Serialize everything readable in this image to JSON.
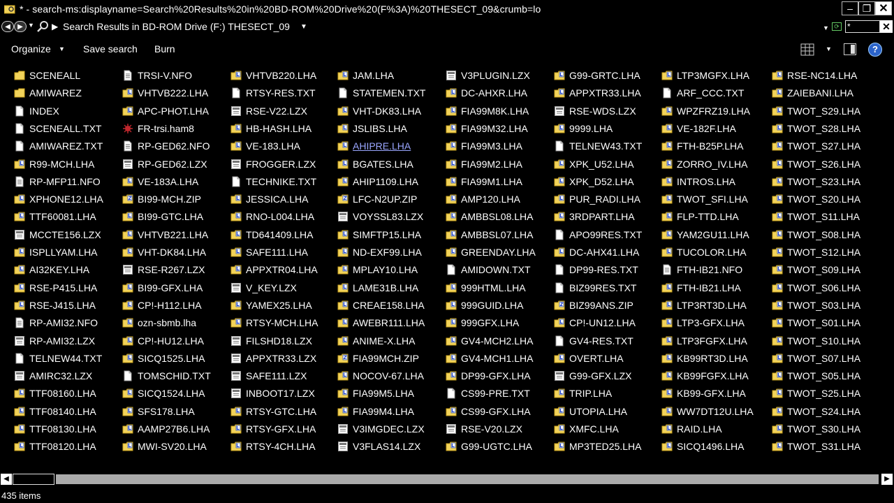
{
  "window": {
    "title": "* - search-ms:displayname=Search%20Results%20in%20BD-ROM%20Drive%20(F%3A)%20THESECT_09&crumb=lo",
    "minimize_glyph": "–",
    "maximize_glyph": "❐",
    "close_glyph": "✕"
  },
  "address": {
    "back_glyph": "◀",
    "forward_glyph": "▶",
    "location": "Search Results in BD-ROM Drive (F:) THESECT_09",
    "search_value": "*",
    "clear_glyph": "✕"
  },
  "toolbar": {
    "organize_label": "Organize",
    "save_search_label": "Save search",
    "burn_label": "Burn",
    "help_label": "?"
  },
  "colors": {
    "folder": "#f2d35a",
    "folder_dark": "#c9a21e",
    "doc": "#ffffff",
    "link_text": "#9aa6ff",
    "help_blue": "#2b63c9"
  },
  "columns": [
    [
      {
        "name": "SCENEALL",
        "icon": "folder"
      },
      {
        "name": "AMIWAREZ",
        "icon": "folder"
      },
      {
        "name": "INDEX",
        "icon": "doc"
      },
      {
        "name": "SCENEALL.TXT",
        "icon": "doc"
      },
      {
        "name": "AMIWAREZ.TXT",
        "icon": "doc"
      },
      {
        "name": "R99-MCH.LHA",
        "icon": "archive"
      },
      {
        "name": "RP-MFP11.NFO",
        "icon": "nfo"
      },
      {
        "name": "XPHONE12.LHA",
        "icon": "archive"
      },
      {
        "name": "TTF60081.LHA",
        "icon": "archive"
      },
      {
        "name": "MCCTE156.LZX",
        "icon": "lzx"
      },
      {
        "name": "ISPLLYAM.LHA",
        "icon": "archive"
      },
      {
        "name": "AI32KEY.LHA",
        "icon": "archive"
      },
      {
        "name": "RSE-P415.LHA",
        "icon": "archive"
      },
      {
        "name": "RSE-J415.LHA",
        "icon": "archive"
      },
      {
        "name": "RP-AMI32.NFO",
        "icon": "nfo"
      },
      {
        "name": "RP-AMI32.LZX",
        "icon": "lzx"
      },
      {
        "name": "TELNEW44.TXT",
        "icon": "doc"
      },
      {
        "name": "AMIRC32.LZX",
        "icon": "lzx"
      },
      {
        "name": "TTF08160.LHA",
        "icon": "archive"
      },
      {
        "name": "TTF08140.LHA",
        "icon": "archive"
      },
      {
        "name": "TTF08130.LHA",
        "icon": "archive"
      },
      {
        "name": "TTF08120.LHA",
        "icon": "archive"
      }
    ],
    [
      {
        "name": "TRSI-V.NFO",
        "icon": "nfo"
      },
      {
        "name": "VHTVB222.LHA",
        "icon": "archive"
      },
      {
        "name": "APC-PHOT.LHA",
        "icon": "archive"
      },
      {
        "name": "FR-trsi.ham8",
        "icon": "ham8"
      },
      {
        "name": "RP-GED62.NFO",
        "icon": "nfo"
      },
      {
        "name": "RP-GED62.LZX",
        "icon": "lzx"
      },
      {
        "name": "VE-183A.LHA",
        "icon": "archive"
      },
      {
        "name": "BI99-MCH.ZIP",
        "icon": "zip"
      },
      {
        "name": "BI99-GTC.LHA",
        "icon": "archive"
      },
      {
        "name": "VHTVB221.LHA",
        "icon": "archive"
      },
      {
        "name": "VHT-DK84.LHA",
        "icon": "archive"
      },
      {
        "name": "RSE-R267.LZX",
        "icon": "lzx"
      },
      {
        "name": "BI99-GFX.LHA",
        "icon": "archive"
      },
      {
        "name": "CP!-H112.LHA",
        "icon": "archive"
      },
      {
        "name": "ozn-sbmb.lha",
        "icon": "archive"
      },
      {
        "name": "CP!-HU12.LHA",
        "icon": "archive"
      },
      {
        "name": "SICQ1525.LHA",
        "icon": "archive"
      },
      {
        "name": "TOMSCHID.TXT",
        "icon": "doc"
      },
      {
        "name": "SICQ1524.LHA",
        "icon": "archive"
      },
      {
        "name": "SFS178.LHA",
        "icon": "archive"
      },
      {
        "name": "AAMP27B6.LHA",
        "icon": "archive"
      },
      {
        "name": "MWI-SV20.LHA",
        "icon": "archive"
      }
    ],
    [
      {
        "name": "VHTVB220.LHA",
        "icon": "archive"
      },
      {
        "name": "RTSY-RES.TXT",
        "icon": "doc"
      },
      {
        "name": "RSE-V22.LZX",
        "icon": "lzx"
      },
      {
        "name": "HB-HASH.LHA",
        "icon": "archive"
      },
      {
        "name": "VE-183.LHA",
        "icon": "archive"
      },
      {
        "name": "FROGGER.LZX",
        "icon": "lzx"
      },
      {
        "name": "TECHNIKE.TXT",
        "icon": "doc"
      },
      {
        "name": "JESSICA.LHA",
        "icon": "archive"
      },
      {
        "name": "RNO-L004.LHA",
        "icon": "archive"
      },
      {
        "name": "TD641409.LHA",
        "icon": "archive"
      },
      {
        "name": "SAFE111.LHA",
        "icon": "archive"
      },
      {
        "name": "APPXTR04.LHA",
        "icon": "archive"
      },
      {
        "name": "V_KEY.LZX",
        "icon": "lzx"
      },
      {
        "name": "YAMEX25.LHA",
        "icon": "archive"
      },
      {
        "name": "RTSY-MCH.LHA",
        "icon": "archive"
      },
      {
        "name": "FILSHD18.LZX",
        "icon": "lzx"
      },
      {
        "name": "APPXTR33.LZX",
        "icon": "lzx"
      },
      {
        "name": "SAFE111.LZX",
        "icon": "lzx"
      },
      {
        "name": "INBOOT17.LZX",
        "icon": "lzx"
      },
      {
        "name": "RTSY-GTC.LHA",
        "icon": "archive"
      },
      {
        "name": "RTSY-GFX.LHA",
        "icon": "archive"
      },
      {
        "name": "RTSY-4CH.LHA",
        "icon": "archive"
      }
    ],
    [
      {
        "name": "JAM.LHA",
        "icon": "archive"
      },
      {
        "name": "STATEMEN.TXT",
        "icon": "doc"
      },
      {
        "name": "VHT-DK83.LHA",
        "icon": "archive"
      },
      {
        "name": "JSLIBS.LHA",
        "icon": "archive"
      },
      {
        "name": "AHIPRE.LHA",
        "icon": "archive",
        "link": true
      },
      {
        "name": "BGATES.LHA",
        "icon": "archive"
      },
      {
        "name": "AHIP1109.LHA",
        "icon": "archive"
      },
      {
        "name": "LFC-N2UP.ZIP",
        "icon": "zip"
      },
      {
        "name": "VOYSSL83.LZX",
        "icon": "lzx"
      },
      {
        "name": "SIMFTP15.LHA",
        "icon": "archive"
      },
      {
        "name": "ND-EXF99.LHA",
        "icon": "archive"
      },
      {
        "name": "MPLAY10.LHA",
        "icon": "archive"
      },
      {
        "name": "LAME31B.LHA",
        "icon": "archive"
      },
      {
        "name": "CREAE158.LHA",
        "icon": "archive"
      },
      {
        "name": "AWEBR111.LHA",
        "icon": "archive"
      },
      {
        "name": "ANIME-X.LHA",
        "icon": "archive"
      },
      {
        "name": "FIA99MCH.ZIP",
        "icon": "zip"
      },
      {
        "name": "NOCOV-67.LHA",
        "icon": "archive"
      },
      {
        "name": "FIA99M5.LHA",
        "icon": "archive"
      },
      {
        "name": "FIA99M4.LHA",
        "icon": "archive"
      },
      {
        "name": "V3IMGDEC.LZX",
        "icon": "lzx"
      },
      {
        "name": "V3FLAS14.LZX",
        "icon": "lzx"
      }
    ],
    [
      {
        "name": "V3PLUGIN.LZX",
        "icon": "lzx"
      },
      {
        "name": "DC-AHXR.LHA",
        "icon": "archive"
      },
      {
        "name": "FIA99M8K.LHA",
        "icon": "archive"
      },
      {
        "name": "FIA99M32.LHA",
        "icon": "archive"
      },
      {
        "name": "FIA99M3.LHA",
        "icon": "archive"
      },
      {
        "name": "FIA99M2.LHA",
        "icon": "archive"
      },
      {
        "name": "FIA99M1.LHA",
        "icon": "archive"
      },
      {
        "name": "AMP120.LHA",
        "icon": "archive"
      },
      {
        "name": "AMBBSL08.LHA",
        "icon": "archive"
      },
      {
        "name": "AMBBSL07.LHA",
        "icon": "archive"
      },
      {
        "name": "GREENDAY.LHA",
        "icon": "archive"
      },
      {
        "name": "AMIDOWN.TXT",
        "icon": "doc"
      },
      {
        "name": "999HTML.LHA",
        "icon": "archive"
      },
      {
        "name": "999GUID.LHA",
        "icon": "archive"
      },
      {
        "name": "999GFX.LHA",
        "icon": "archive"
      },
      {
        "name": "GV4-MCH2.LHA",
        "icon": "archive"
      },
      {
        "name": "GV4-MCH1.LHA",
        "icon": "archive"
      },
      {
        "name": "DP99-GFX.LHA",
        "icon": "archive"
      },
      {
        "name": "CS99-PRE.TXT",
        "icon": "doc"
      },
      {
        "name": "CS99-GFX.LHA",
        "icon": "archive"
      },
      {
        "name": "RSE-V20.LZX",
        "icon": "lzx"
      },
      {
        "name": "G99-UGTC.LHA",
        "icon": "archive"
      }
    ],
    [
      {
        "name": "G99-GRTC.LHA",
        "icon": "archive"
      },
      {
        "name": "APPXTR33.LHA",
        "icon": "archive"
      },
      {
        "name": "RSE-WDS.LZX",
        "icon": "lzx"
      },
      {
        "name": "9999.LHA",
        "icon": "archive"
      },
      {
        "name": "TELNEW43.TXT",
        "icon": "doc"
      },
      {
        "name": "XPK_U52.LHA",
        "icon": "archive"
      },
      {
        "name": "XPK_D52.LHA",
        "icon": "archive"
      },
      {
        "name": "PUR_RADI.LHA",
        "icon": "archive"
      },
      {
        "name": "3RDPART.LHA",
        "icon": "archive"
      },
      {
        "name": "APO99RES.TXT",
        "icon": "doc"
      },
      {
        "name": "DC-AHX41.LHA",
        "icon": "archive"
      },
      {
        "name": "DP99-RES.TXT",
        "icon": "doc"
      },
      {
        "name": "BIZ99RES.TXT",
        "icon": "doc"
      },
      {
        "name": "BIZ99ANS.ZIP",
        "icon": "zip"
      },
      {
        "name": "CP!-UN12.LHA",
        "icon": "archive"
      },
      {
        "name": "GV4-RES.TXT",
        "icon": "doc"
      },
      {
        "name": "OVERT.LHA",
        "icon": "archive"
      },
      {
        "name": "G99-GFX.LZX",
        "icon": "lzx"
      },
      {
        "name": "TRIP.LHA",
        "icon": "archive"
      },
      {
        "name": "UTOPIA.LHA",
        "icon": "archive"
      },
      {
        "name": "XMFC.LHA",
        "icon": "archive"
      },
      {
        "name": "MP3TED25.LHA",
        "icon": "archive"
      }
    ],
    [
      {
        "name": "LTP3MGFX.LHA",
        "icon": "archive"
      },
      {
        "name": "ARF_CCC.TXT",
        "icon": "doc"
      },
      {
        "name": "WPZFRZ19.LHA",
        "icon": "archive"
      },
      {
        "name": "VE-182F.LHA",
        "icon": "archive"
      },
      {
        "name": "FTH-B25P.LHA",
        "icon": "archive"
      },
      {
        "name": "ZORRO_IV.LHA",
        "icon": "archive"
      },
      {
        "name": "INTROS.LHA",
        "icon": "archive"
      },
      {
        "name": "TWOT_SFI.LHA",
        "icon": "archive"
      },
      {
        "name": "FLP-TTD.LHA",
        "icon": "archive"
      },
      {
        "name": "YAM2GU11.LHA",
        "icon": "archive"
      },
      {
        "name": "TUCOLOR.LHA",
        "icon": "archive"
      },
      {
        "name": "FTH-IB21.NFO",
        "icon": "nfo"
      },
      {
        "name": "FTH-IB21.LHA",
        "icon": "archive"
      },
      {
        "name": "LTP3RT3D.LHA",
        "icon": "archive"
      },
      {
        "name": "LTP3-GFX.LHA",
        "icon": "archive"
      },
      {
        "name": "LTP3FGFX.LHA",
        "icon": "archive"
      },
      {
        "name": "KB99RT3D.LHA",
        "icon": "archive"
      },
      {
        "name": "KB99FGFX.LHA",
        "icon": "archive"
      },
      {
        "name": "KB99-GFX.LHA",
        "icon": "archive"
      },
      {
        "name": "WW7DT12U.LHA",
        "icon": "archive"
      },
      {
        "name": "RAID.LHA",
        "icon": "archive"
      },
      {
        "name": "SICQ1496.LHA",
        "icon": "archive"
      }
    ],
    [
      {
        "name": "RSE-NC14.LHA",
        "icon": "archive"
      },
      {
        "name": "ZAIEBANI.LHA",
        "icon": "archive"
      },
      {
        "name": "TWOT_S29.LHA",
        "icon": "archive"
      },
      {
        "name": "TWOT_S28.LHA",
        "icon": "archive"
      },
      {
        "name": "TWOT_S27.LHA",
        "icon": "archive"
      },
      {
        "name": "TWOT_S26.LHA",
        "icon": "archive"
      },
      {
        "name": "TWOT_S23.LHA",
        "icon": "archive"
      },
      {
        "name": "TWOT_S20.LHA",
        "icon": "archive"
      },
      {
        "name": "TWOT_S11.LHA",
        "icon": "archive"
      },
      {
        "name": "TWOT_S08.LHA",
        "icon": "archive"
      },
      {
        "name": "TWOT_S12.LHA",
        "icon": "archive"
      },
      {
        "name": "TWOT_S09.LHA",
        "icon": "archive"
      },
      {
        "name": "TWOT_S06.LHA",
        "icon": "archive"
      },
      {
        "name": "TWOT_S03.LHA",
        "icon": "archive"
      },
      {
        "name": "TWOT_S01.LHA",
        "icon": "archive"
      },
      {
        "name": "TWOT_S10.LHA",
        "icon": "archive"
      },
      {
        "name": "TWOT_S07.LHA",
        "icon": "archive"
      },
      {
        "name": "TWOT_S05.LHA",
        "icon": "archive"
      },
      {
        "name": "TWOT_S25.LHA",
        "icon": "archive"
      },
      {
        "name": "TWOT_S24.LHA",
        "icon": "archive"
      },
      {
        "name": "TWOT_S30.LHA",
        "icon": "archive"
      },
      {
        "name": "TWOT_S31.LHA",
        "icon": "archive"
      }
    ]
  ],
  "status": {
    "item_count": "435 items"
  },
  "scroll": {
    "left_glyph": "◀",
    "right_glyph": "▶"
  }
}
